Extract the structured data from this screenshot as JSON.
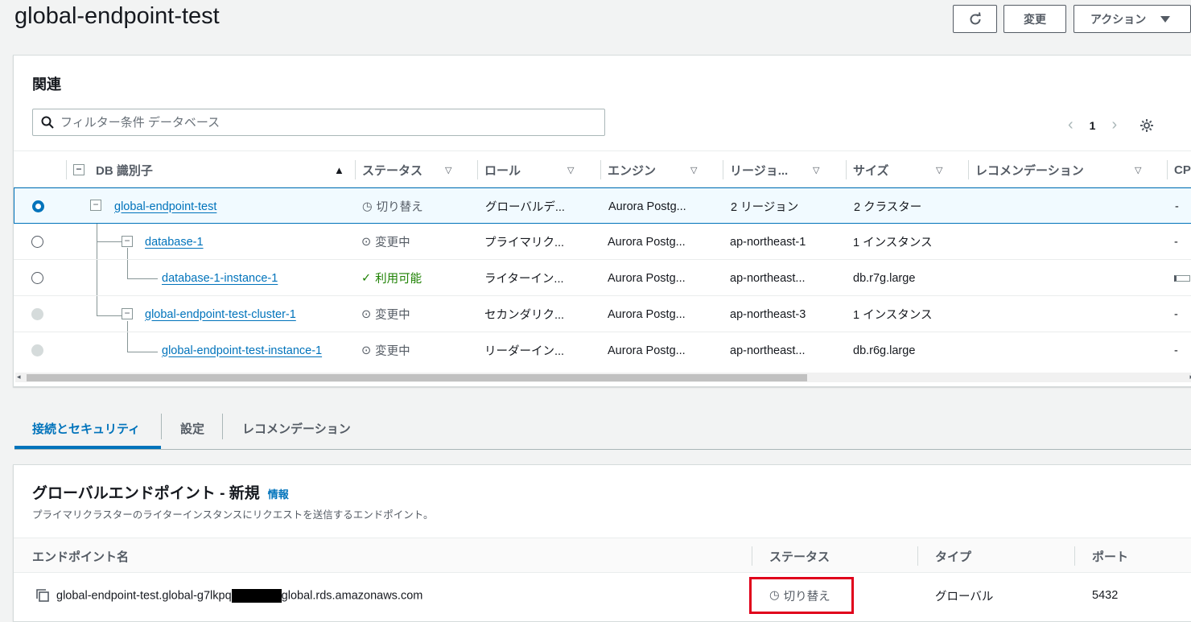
{
  "header": {
    "title": "global-endpoint-test",
    "modify_label": "変更",
    "actions_label": "アクション"
  },
  "related": {
    "title": "関連",
    "search_placeholder": "フィルター条件 データベース",
    "page": "1",
    "columns": [
      "DB 識別子",
      "ステータス",
      "ロール",
      "エンジン",
      "リージョ...",
      "サイズ",
      "レコメンデーション",
      "CPU"
    ],
    "rows": [
      {
        "id": "global-endpoint-test",
        "status": "切り替え",
        "role": "グローバルデ...",
        "engine": "Aurora Postg...",
        "region": "2 リージョン",
        "size": "2 クラスター",
        "cpu": "-"
      },
      {
        "id": "database-1",
        "status": "変更中",
        "role": "プライマリク...",
        "engine": "Aurora Postg...",
        "region": "ap-northeast-1",
        "size": "1 インスタンス",
        "cpu": "-"
      },
      {
        "id": "database-1-instance-1",
        "status": "利用可能",
        "role": "ライターイン...",
        "engine": "Aurora Postg...",
        "region": "ap-northeast...",
        "size": "db.r7g.large",
        "cpu": ""
      },
      {
        "id": "global-endpoint-test-cluster-1",
        "status": "変更中",
        "role": "セカンダリク...",
        "engine": "Aurora Postg...",
        "region": "ap-northeast-3",
        "size": "1 インスタンス",
        "cpu": "-"
      },
      {
        "id": "global-endpoint-test-instance-1",
        "status": "変更中",
        "role": "リーダーイン...",
        "engine": "Aurora Postg...",
        "region": "ap-northeast...",
        "size": "db.r6g.large",
        "cpu": "-"
      }
    ]
  },
  "tabs": [
    "接続とセキュリティ",
    "設定",
    "レコメンデーション"
  ],
  "endpoint": {
    "title": "グローバルエンドポイント - 新規",
    "info": "情報",
    "description": "プライマリクラスターのライターインスタンスにリクエストを送信するエンドポイント。",
    "columns": [
      "エンドポイント名",
      "ステータス",
      "タイプ",
      "ポート"
    ],
    "row": {
      "name_prefix": "global-endpoint-test.global-g7lkpq",
      "name_suffix": "global.rds.amazonaws.com",
      "status": "切り替え",
      "type": "グローバル",
      "port": "5432"
    }
  }
}
